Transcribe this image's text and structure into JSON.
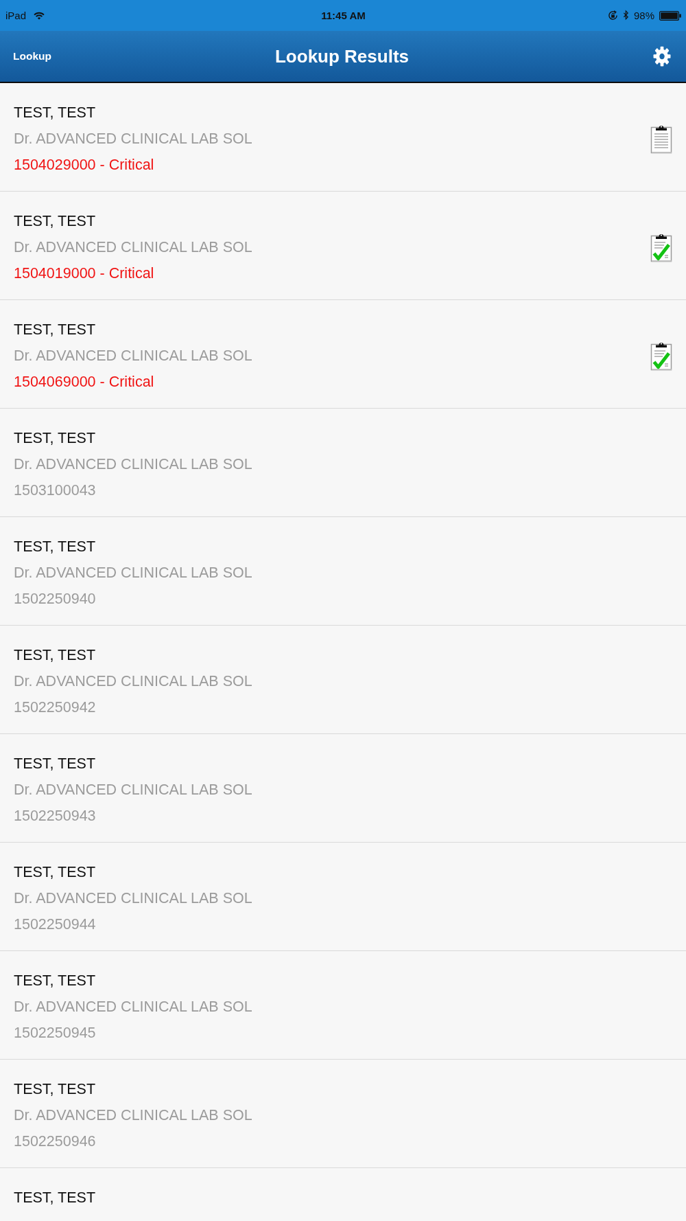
{
  "status_bar": {
    "device": "iPad",
    "time": "11:45 AM",
    "battery": "98%"
  },
  "nav_bar": {
    "back": "Lookup",
    "title": "Lookup Results"
  },
  "rows": [
    {
      "name": "TEST, TEST",
      "doctor": "Dr. ADVANCED CLINICAL LAB SOL",
      "number": "1504029000 - Critical",
      "critical": true,
      "report": {
        "checked": false
      }
    },
    {
      "name": "TEST, TEST",
      "doctor": "Dr. ADVANCED CLINICAL LAB SOL",
      "number": "1504019000 - Critical",
      "critical": true,
      "report": {
        "checked": true
      }
    },
    {
      "name": "TEST, TEST",
      "doctor": "Dr. ADVANCED CLINICAL LAB SOL",
      "number": "1504069000 - Critical",
      "critical": true,
      "report": {
        "checked": true
      }
    },
    {
      "name": "TEST, TEST",
      "doctor": "Dr. ADVANCED CLINICAL LAB SOL",
      "number": "1503100043",
      "critical": false
    },
    {
      "name": "TEST, TEST",
      "doctor": "Dr. ADVANCED CLINICAL LAB SOL",
      "number": "1502250940",
      "critical": false
    },
    {
      "name": "TEST, TEST",
      "doctor": "Dr. ADVANCED CLINICAL LAB SOL",
      "number": "1502250942",
      "critical": false
    },
    {
      "name": "TEST, TEST",
      "doctor": "Dr. ADVANCED CLINICAL LAB SOL",
      "number": "1502250943",
      "critical": false
    },
    {
      "name": "TEST, TEST",
      "doctor": "Dr. ADVANCED CLINICAL LAB SOL",
      "number": "1502250944",
      "critical": false
    },
    {
      "name": "TEST, TEST",
      "doctor": "Dr. ADVANCED CLINICAL LAB SOL",
      "number": "1502250945",
      "critical": false
    },
    {
      "name": "TEST, TEST",
      "doctor": "Dr. ADVANCED CLINICAL LAB SOL",
      "number": "1502250946",
      "critical": false
    },
    {
      "name": "TEST, TEST"
    }
  ]
}
